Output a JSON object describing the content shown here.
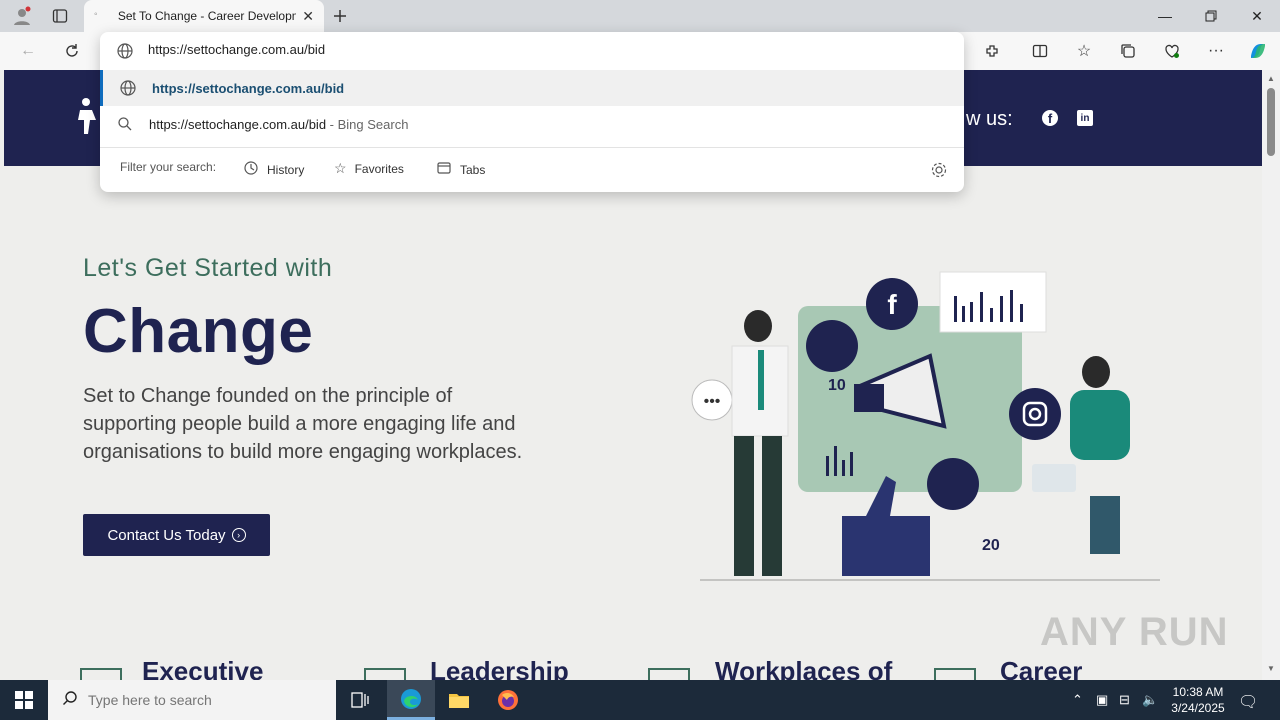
{
  "browser": {
    "tab_title": "Set To Change - Career Developm",
    "address_value": "https://settochange.com.au/bid",
    "suggestions": [
      {
        "text": "https://settochange.com.au/bid",
        "suffix": ""
      },
      {
        "text": "https://settochange.com.au/bid",
        "suffix": " - Bing Search"
      }
    ],
    "filter_label": "Filter your search:",
    "filters": [
      "History",
      "Favorites",
      "Tabs"
    ]
  },
  "site": {
    "follow_text": "w us:",
    "hero_subtitle": "Let's Get Started with",
    "hero_title": "Change",
    "hero_description": "Set to Change founded on the principle of supporting people build a more engaging life and organisations to build more engaging workplaces.",
    "cta_label": "Contact Us Today",
    "features": [
      "Executive",
      "Leadership",
      "Workplaces of",
      "Career"
    ],
    "illustration_labels": [
      "10",
      "20"
    ]
  },
  "watermark": "ANY RUN",
  "taskbar": {
    "search_placeholder": "Type here to search",
    "time": "10:38 AM",
    "date": "3/24/2025"
  },
  "colors": {
    "brand_navy": "#1f2350",
    "brand_green": "#3d6e5d",
    "tabbar": "#d5d8dc",
    "taskbar": "#1c2a3a"
  }
}
